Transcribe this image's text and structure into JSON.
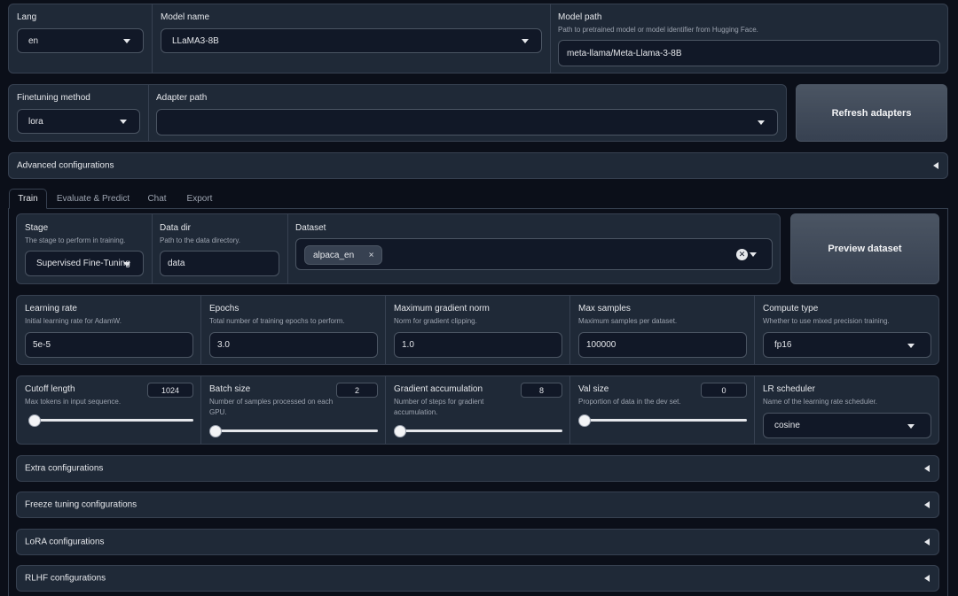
{
  "top": {
    "lang": {
      "label": "Lang",
      "value": "en"
    },
    "model_name": {
      "label": "Model name",
      "value": "LLaMA3-8B"
    },
    "model_path": {
      "label": "Model path",
      "info": "Path to pretrained model or model identifier from Hugging Face.",
      "value": "meta-llama/Meta-Llama-3-8B"
    }
  },
  "row2": {
    "finetuning_method": {
      "label": "Finetuning method",
      "value": "lora"
    },
    "adapter_path": {
      "label": "Adapter path",
      "value": ""
    },
    "refresh_label": "Refresh adapters"
  },
  "advanced": {
    "label": "Advanced configurations"
  },
  "tabs": [
    {
      "label": "Train"
    },
    {
      "label": "Evaluate & Predict"
    },
    {
      "label": "Chat"
    },
    {
      "label": "Export"
    }
  ],
  "train": {
    "stage": {
      "label": "Stage",
      "info": "The stage to perform in training.",
      "value": "Supervised Fine-Tuning"
    },
    "data_dir": {
      "label": "Data dir",
      "info": "Path to the data directory.",
      "value": "data"
    },
    "dataset": {
      "label": "Dataset",
      "selected": [
        "alpaca_en"
      ]
    },
    "preview_label": "Preview dataset",
    "learning_rate": {
      "label": "Learning rate",
      "info": "Initial learning rate for AdamW.",
      "value": "5e-5"
    },
    "epochs": {
      "label": "Epochs",
      "info": "Total number of training epochs to perform.",
      "value": "3.0"
    },
    "max_grad_norm": {
      "label": "Maximum gradient norm",
      "info": "Norm for gradient clipping.",
      "value": "1.0"
    },
    "max_samples": {
      "label": "Max samples",
      "info": "Maximum samples per dataset.",
      "value": "100000"
    },
    "compute_type": {
      "label": "Compute type",
      "info": "Whether to use mixed precision training.",
      "value": "fp16"
    },
    "cutoff_len": {
      "label": "Cutoff length",
      "info": "Max tokens in input sequence.",
      "value": "1024",
      "slider_fraction": 0.0
    },
    "batch_size": {
      "label": "Batch size",
      "info": "Number of samples processed on each GPU.",
      "value": "2",
      "slider_fraction": 0.0
    },
    "grad_accum": {
      "label": "Gradient accumulation",
      "info": "Number of steps for gradient accumulation.",
      "value": "8",
      "slider_fraction": 0.0
    },
    "val_size": {
      "label": "Val size",
      "info": "Proportion of data in the dev set.",
      "value": "0",
      "slider_fraction": 0.0
    },
    "lr_scheduler": {
      "label": "LR scheduler",
      "info": "Name of the learning rate scheduler.",
      "value": "cosine"
    }
  },
  "accordions": [
    {
      "label": "Extra configurations"
    },
    {
      "label": "Freeze tuning configurations"
    },
    {
      "label": "LoRA configurations"
    },
    {
      "label": "RLHF configurations"
    }
  ]
}
